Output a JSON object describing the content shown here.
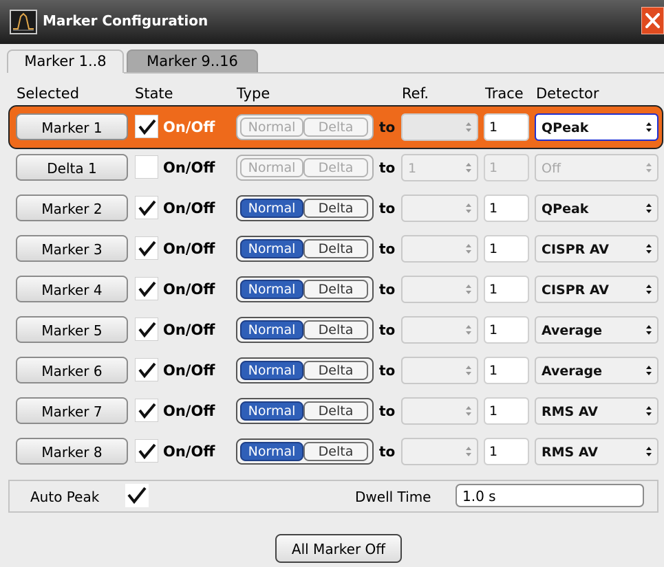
{
  "window": {
    "title": "Marker Configuration",
    "icon": "spectrum-icon",
    "close_icon": "close-icon"
  },
  "tabs": [
    {
      "label": "Marker 1..8",
      "active": true
    },
    {
      "label": "Marker 9..16",
      "active": false
    }
  ],
  "headers": {
    "selected": "Selected",
    "state": "State",
    "type": "Type",
    "ref": "Ref.",
    "trace": "Trace",
    "detector": "Detector"
  },
  "connector": "to",
  "type_options": {
    "normal": "Normal",
    "delta": "Delta"
  },
  "state_label": "On/Off",
  "rows": [
    {
      "name": "Marker 1",
      "on": true,
      "type": "Normal",
      "type_enabled": false,
      "ref": "",
      "trace": "1",
      "detector": "QPeak",
      "selected": true
    },
    {
      "name": "Delta 1",
      "on": false,
      "type": "",
      "type_enabled": false,
      "ref": "1",
      "trace": "1",
      "detector": "Off",
      "disabled": true
    },
    {
      "name": "Marker 2",
      "on": true,
      "type": "Normal",
      "type_enabled": true,
      "ref": "",
      "trace": "1",
      "detector": "QPeak"
    },
    {
      "name": "Marker 3",
      "on": true,
      "type": "Normal",
      "type_enabled": true,
      "ref": "",
      "trace": "1",
      "detector": "CISPR AV"
    },
    {
      "name": "Marker 4",
      "on": true,
      "type": "Normal",
      "type_enabled": true,
      "ref": "",
      "trace": "1",
      "detector": "CISPR AV"
    },
    {
      "name": "Marker 5",
      "on": true,
      "type": "Normal",
      "type_enabled": true,
      "ref": "",
      "trace": "1",
      "detector": "Average"
    },
    {
      "name": "Marker 6",
      "on": true,
      "type": "Normal",
      "type_enabled": true,
      "ref": "",
      "trace": "1",
      "detector": "Average"
    },
    {
      "name": "Marker 7",
      "on": true,
      "type": "Normal",
      "type_enabled": true,
      "ref": "",
      "trace": "1",
      "detector": "RMS AV"
    },
    {
      "name": "Marker 8",
      "on": true,
      "type": "Normal",
      "type_enabled": true,
      "ref": "",
      "trace": "1",
      "detector": "RMS AV"
    }
  ],
  "auto_peak": {
    "label": "Auto Peak",
    "checked": true
  },
  "dwell_time": {
    "label": "Dwell Time",
    "value": "1.0 s"
  },
  "all_marker_off": "All Marker Off",
  "colors": {
    "selected_row": "#ee6a1b",
    "normal_active": "#2f5fb8",
    "titlebar": "#333333",
    "close": "#e04b1f"
  }
}
